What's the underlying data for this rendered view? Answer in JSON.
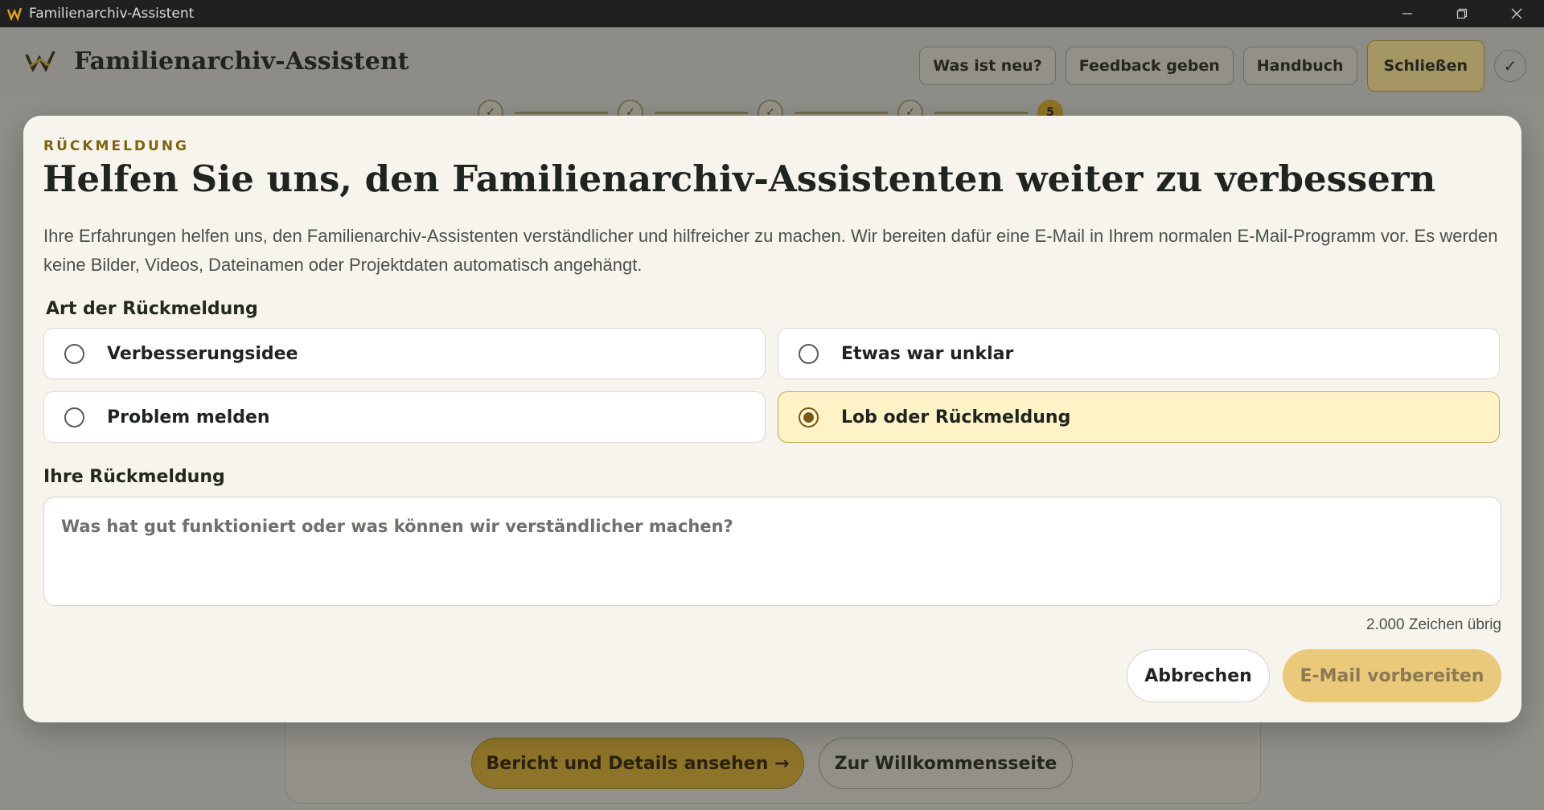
{
  "window": {
    "title": "Familienarchiv-Assistent"
  },
  "header": {
    "title": "Familienarchiv-Assistent",
    "buttons": {
      "whats_new": "Was ist neu?",
      "feedback": "Feedback geben",
      "manual": "Handbuch",
      "close": "Schließen"
    },
    "check_symbol": "✓"
  },
  "stepper": {
    "steps": [
      "✓",
      "✓",
      "✓",
      "✓",
      "5"
    ],
    "current": 5
  },
  "background": {
    "primary_button": "Bericht und Details ansehen →",
    "secondary_button": "Zur Willkommensseite"
  },
  "modal": {
    "eyebrow": "RÜCKMELDUNG",
    "title": "Helfen Sie uns, den Familienarchiv-Assistenten weiter zu verbessern",
    "description": "Ihre Erfahrungen helfen uns, den Familienarchiv-Assistenten verständlicher und hilfreicher zu machen. Wir bereiten dafür eine E-Mail in Ihrem normalen E-Mail-Programm vor. Es werden keine Bilder, Videos, Dateinamen oder Projektdaten automatisch angehängt.",
    "type_label": "Art der Rückmeldung",
    "options": [
      {
        "label": "Verbesserungsidee",
        "selected": false
      },
      {
        "label": "Etwas war unklar",
        "selected": false
      },
      {
        "label": "Problem melden",
        "selected": false
      },
      {
        "label": "Lob oder Rückmeldung",
        "selected": true
      }
    ],
    "message_label": "Ihre Rückmeldung",
    "message_value": "",
    "message_placeholder": "Was hat gut funktioniert oder was können wir verständlicher machen?",
    "char_counter": "2.000 Zeichen übrig",
    "cancel_button": "Abbrechen",
    "submit_button": "E-Mail vorbereiten"
  },
  "colors": {
    "accent_gold": "#ebc97a",
    "eyebrow_gold": "#7d6410",
    "selected_bg": "#fdf3c7",
    "modal_bg": "#f7f4ee"
  }
}
